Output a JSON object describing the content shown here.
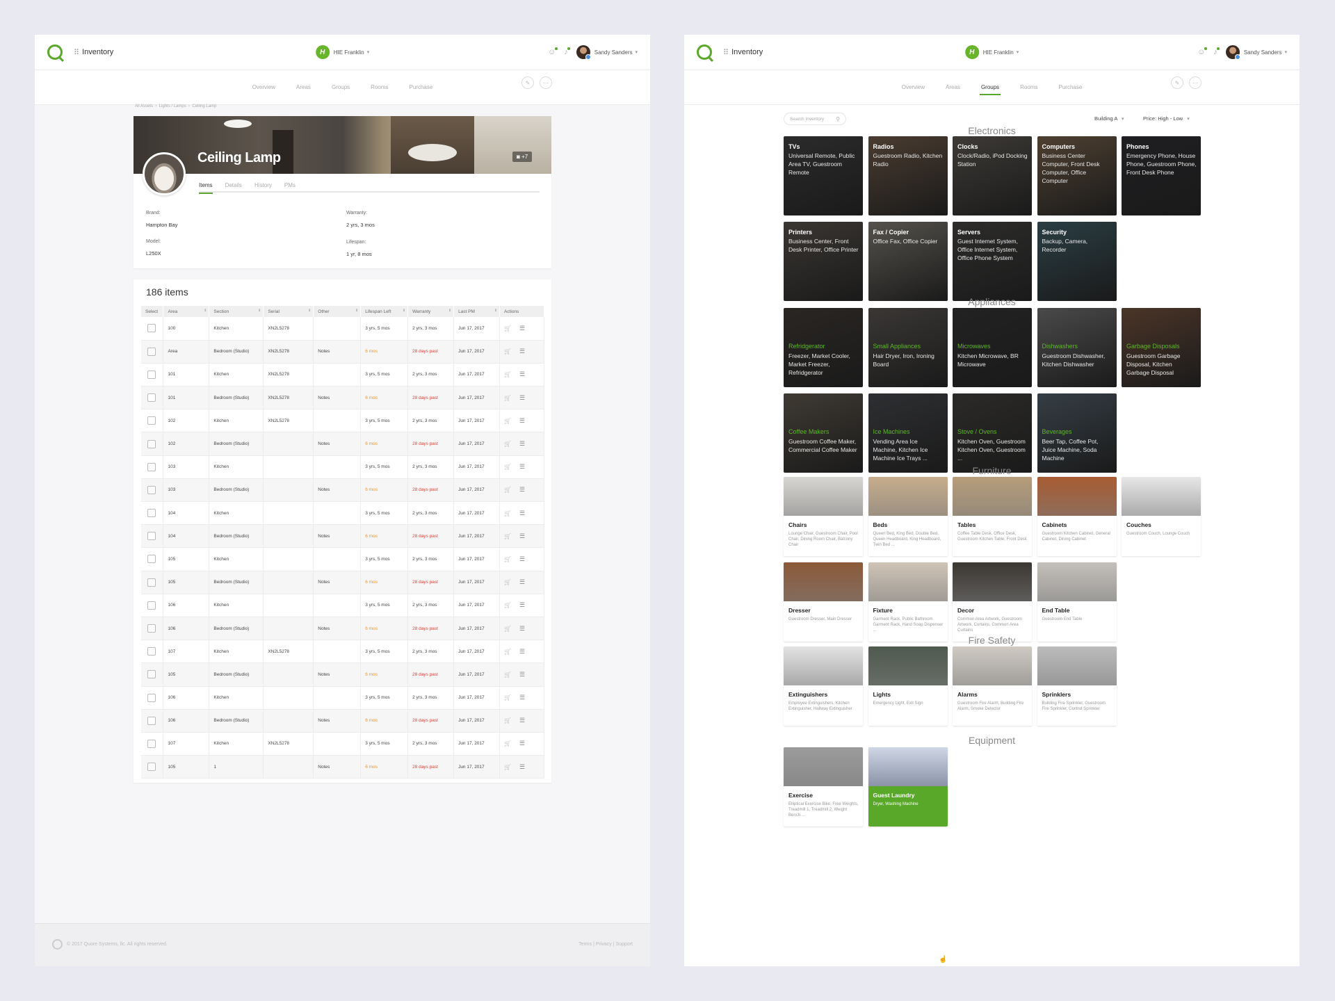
{
  "left": {
    "app_title": "Inventory",
    "hotel": "HIE Franklin",
    "user": "Sandy Sanders",
    "tabs": [
      "Overview",
      "Areas",
      "Groups",
      "Rooms",
      "Purchase"
    ],
    "breadcrumb": [
      "All Assets",
      "Lights / Lamps",
      "Ceiling Lamp"
    ],
    "asset_title": "Ceiling Lamp",
    "photo_count": "+7",
    "detail_tabs": [
      "Items",
      "Details",
      "History",
      "PMs"
    ],
    "fields": {
      "brand_label": "Brand:",
      "brand": "Hampton Bay",
      "model_label": "Model:",
      "model": "L250X",
      "warranty_label": "Warranty:",
      "warranty": "2 yrs, 3 mos",
      "lifespan_label": "Lifespan:",
      "lifespan": "1 yr, 8 mos"
    },
    "items_count": "186 items",
    "columns": [
      "Select",
      "Area",
      "Section",
      "Serial",
      "Other",
      "Lifespan Left",
      "Warranty",
      "Last PM",
      "Actions"
    ],
    "rows": [
      [
        "100",
        "Kitchen",
        "XN2L5278",
        "",
        "3 yrs, 5 mos",
        "2 yrs, 3 mos",
        "Jun 17, 2017"
      ],
      [
        "Area",
        "Bedroom (Studio)",
        "XN2L5278",
        "Notes",
        "6 mos",
        "28 days past",
        "Jun 17, 2017"
      ],
      [
        "101",
        "Kitchen",
        "XN2L5278",
        "",
        "3 yrs, 5 mos",
        "2 yrs, 3 mos",
        "Jun 17, 2017"
      ],
      [
        "101",
        "Bedroom (Studio)",
        "XN2L5278",
        "Notes",
        "6 mos",
        "28 days past",
        "Jun 17, 2017"
      ],
      [
        "102",
        "Kitchen",
        "XN2L5278",
        "",
        "3 yrs, 5 mos",
        "2 yrs, 3 mos",
        "Jun 17, 2017"
      ],
      [
        "102",
        "Bedroom (Studio)",
        "",
        "Notes",
        "6 mos",
        "28 days past",
        "Jun 17, 2017"
      ],
      [
        "103",
        "Kitchen",
        "",
        "",
        "3 yrs, 5 mos",
        "2 yrs, 3 mos",
        "Jun 17, 2017"
      ],
      [
        "103",
        "Bedroom (Studio)",
        "",
        "Notes",
        "6 mos",
        "28 days past",
        "Jun 17, 2017"
      ],
      [
        "104",
        "Kitchen",
        "",
        "",
        "3 yrs, 5 mos",
        "2 yrs, 3 mos",
        "Jun 17, 2017"
      ],
      [
        "104",
        "Bedroom (Studio)",
        "",
        "Notes",
        "6 mos",
        "28 days past",
        "Jun 17, 2017"
      ],
      [
        "105",
        "Kitchen",
        "",
        "",
        "3 yrs, 5 mos",
        "2 yrs, 3 mos",
        "Jun 17, 2017"
      ],
      [
        "105",
        "Bedroom (Studio)",
        "",
        "Notes",
        "6 mos",
        "28 days past",
        "Jun 17, 2017"
      ],
      [
        "106",
        "Kitchen",
        "",
        "",
        "3 yrs, 5 mos",
        "2 yrs, 3 mos",
        "Jun 17, 2017"
      ],
      [
        "106",
        "Bedroom (Studio)",
        "",
        "Notes",
        "6 mos",
        "28 days past",
        "Jun 17, 2017"
      ],
      [
        "107",
        "Kitchen",
        "XN2L5278",
        "",
        "3 yrs, 5 mos",
        "2 yrs, 3 mos",
        "Jun 17, 2017"
      ],
      [
        "105",
        "Bedroom (Studio)",
        "",
        "Notes",
        "6 mos",
        "28 days past",
        "Jun 17, 2017"
      ],
      [
        "106",
        "Kitchen",
        "",
        "",
        "3 yrs, 5 mos",
        "2 yrs, 3 mos",
        "Jun 17, 2017"
      ],
      [
        "106",
        "Bedroom (Studio)",
        "",
        "Notes",
        "6 mos",
        "28 days past",
        "Jun 17, 2017"
      ],
      [
        "107",
        "Kitchen",
        "XN2L5278",
        "",
        "3 yrs, 5 mos",
        "2 yrs, 3 mos",
        "Jun 17, 2017"
      ],
      [
        "105",
        "1",
        "",
        "Notes",
        "6 mos",
        "28 days past",
        "Jun 17, 2017"
      ]
    ],
    "footer_copy": "© 2017 Quore Systems, llc. All rights reserved.",
    "footer_links": "Terms | Privacy | Support"
  },
  "right": {
    "app_title": "Inventory",
    "hotel": "HIE Franklin",
    "user": "Sandy Sanders",
    "tabs": [
      "Overview",
      "Areas",
      "Groups",
      "Rooms",
      "Purchase"
    ],
    "active_tab": "Groups",
    "search_placeholder": "Search Inventory",
    "filter_building": "Building A",
    "filter_sort": "Price: High - Low",
    "sections": [
      {
        "title": "Electronics",
        "style": "dark",
        "tiles": [
          {
            "name": "TVs",
            "desc": "Universal Remote, Public Area TV, Guestroom Remote"
          },
          {
            "name": "Radios",
            "desc": "Guestroom Radio, Kitchen Radio"
          },
          {
            "name": "Clocks",
            "desc": "Clock/Radio, iPod Docking Station"
          },
          {
            "name": "Computers",
            "desc": "Business Center Computer, Front Desk Computer, Office Computer"
          },
          {
            "name": "Phones",
            "desc": "Emergency Phone, House Phone, Guestroom Phone, Front Desk Phone"
          },
          {
            "name": "Printers",
            "desc": "Business Center, Front Desk Printer, Office Printer"
          },
          {
            "name": "Fax / Copier",
            "desc": "Office Fax, Office Copier"
          },
          {
            "name": "Servers",
            "desc": "Guest Internet System, Office Internet System, Office Phone System"
          },
          {
            "name": "Security",
            "desc": "Backup, Camera, Recorder"
          }
        ]
      },
      {
        "title": "Appliances",
        "style": "dark-green",
        "tiles": [
          {
            "name": "Refridgerator",
            "desc": "Freezer, Market Cooler, Market Freezer, Refridgerator"
          },
          {
            "name": "Small Appliances",
            "desc": "Hair Dryer, Iron, Ironing Board"
          },
          {
            "name": "Microwaves",
            "desc": "Kitchen Microwave, BR Microwave"
          },
          {
            "name": "Dishwashers",
            "desc": "Guestroom Dishwasher, Kitchen Dishwasher"
          },
          {
            "name": "Garbage Disposals",
            "desc": "Guestroom Garbage Disposal, Kitchen Garbage Disposal"
          },
          {
            "name": "Coffee Makers",
            "desc": "Guestroom Coffee Maker, Commercial Coffee Maker"
          },
          {
            "name": "Ice Machines",
            "desc": "Vending Area Ice Machine, Kitchen Ice Machine Ice Trays ..."
          },
          {
            "name": "Stove / Ovens",
            "desc": "Kitchen Oven, Guestroom Kitchen Oven, Guestroom ..."
          },
          {
            "name": "Beverages",
            "desc": "Beer Tap, Coffee Pot, Juice Machine, Soda Machine"
          }
        ]
      },
      {
        "title": "Furniture",
        "style": "light",
        "tiles": [
          {
            "name": "Chairs",
            "desc": "Lounge Chair, Guestroom Chair, Pool Chair, Dining Room Chair, Balcony Chair"
          },
          {
            "name": "Beds",
            "desc": "Queen Bed, King Bed, Double Bed, Queen Headboard, King Headboard, Twin Bed ..."
          },
          {
            "name": "Tables",
            "desc": "Coffee Table Desk, Office Desk, Guestroom Kitchen Table, Front Desk"
          },
          {
            "name": "Cabinets",
            "desc": "Guestroom Kitchen Cabinet, General Cabinet, Dining Cabinet"
          },
          {
            "name": "Couches",
            "desc": "Guestroom Couch, Lounge Couch"
          },
          {
            "name": "Dresser",
            "desc": "Guestroom Dresser, Main Dresser"
          },
          {
            "name": "Fixture",
            "desc": "Garment Rack, Public Bathroom Garment Rack, Hand Soap Dispenser ..."
          },
          {
            "name": "Decor",
            "desc": "Common Area Artwork, Guestroom Artwork, Curtains, Common Area Curtains"
          },
          {
            "name": "End Table",
            "desc": "Guestroom End Table"
          }
        ]
      },
      {
        "title": "Fire Safety",
        "style": "light",
        "tiles": [
          {
            "name": "Extinguishers",
            "desc": "Employee Extinguishers, Kitchen Extinguisher, Hallway Extinguisher"
          },
          {
            "name": "Lights",
            "desc": "Emergency Light, Exit Sign"
          },
          {
            "name": "Alarms",
            "desc": "Guestroom Fire Alarm, Building Fire Alarm, Smoke Detector"
          },
          {
            "name": "Sprinklers",
            "desc": "Building Fire Sprinkler, Guestroom Fire Sprinkler, Control Sprinkler"
          }
        ]
      },
      {
        "title": "Equipment",
        "style": "light",
        "tiles": [
          {
            "name": "Exercise",
            "desc": "Elliptical Exercise Bike, Free Weights, Treadmill 1, Treadmill 2, Weight Bench ..."
          },
          {
            "name": "Guest Laundry",
            "desc": "Dryer, Washing Machine"
          }
        ]
      }
    ]
  },
  "colors": {
    "accent": "#5aa82a",
    "warning": "#f0962e",
    "error": "#e0433a"
  }
}
